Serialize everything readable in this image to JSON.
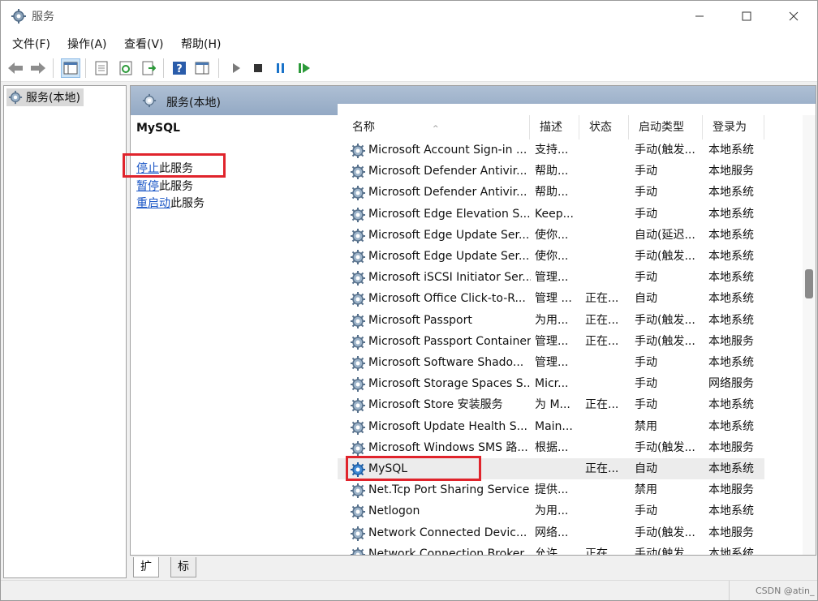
{
  "window": {
    "title": "服务"
  },
  "menu": [
    "文件(F)",
    "操作(A)",
    "查看(V)",
    "帮助(H)"
  ],
  "tree": {
    "root": "服务(本地)"
  },
  "pane": {
    "title": "服务(本地)"
  },
  "extended": {
    "service_name": "MySQL",
    "actions": [
      {
        "link": "停止",
        "rest": "此服务"
      },
      {
        "link": "暂停",
        "rest": "此服务"
      },
      {
        "link": "重启动",
        "rest": "此服务"
      }
    ]
  },
  "columns": [
    "名称",
    "描述",
    "状态",
    "启动类型",
    "登录为"
  ],
  "services": [
    {
      "name": "Microsoft Account Sign-in ...",
      "desc": "支持...",
      "status": "",
      "startup": "手动(触发...",
      "logon": "本地系统"
    },
    {
      "name": "Microsoft Defender Antivir...",
      "desc": "帮助...",
      "status": "",
      "startup": "手动",
      "logon": "本地服务"
    },
    {
      "name": "Microsoft Defender Antivir...",
      "desc": "帮助...",
      "status": "",
      "startup": "手动",
      "logon": "本地系统"
    },
    {
      "name": "Microsoft Edge Elevation S...",
      "desc": "Keep...",
      "status": "",
      "startup": "手动",
      "logon": "本地系统"
    },
    {
      "name": "Microsoft Edge Update Ser...",
      "desc": "使你...",
      "status": "",
      "startup": "自动(延迟...",
      "logon": "本地系统"
    },
    {
      "name": "Microsoft Edge Update Ser...",
      "desc": "使你...",
      "status": "",
      "startup": "手动(触发...",
      "logon": "本地系统"
    },
    {
      "name": "Microsoft iSCSI Initiator Ser...",
      "desc": "管理...",
      "status": "",
      "startup": "手动",
      "logon": "本地系统"
    },
    {
      "name": "Microsoft Office Click-to-R...",
      "desc": "管理 ...",
      "status": "正在...",
      "startup": "自动",
      "logon": "本地系统"
    },
    {
      "name": "Microsoft Passport",
      "desc": "为用...",
      "status": "正在...",
      "startup": "手动(触发...",
      "logon": "本地系统"
    },
    {
      "name": "Microsoft Passport Container",
      "desc": "管理...",
      "status": "正在...",
      "startup": "手动(触发...",
      "logon": "本地服务"
    },
    {
      "name": "Microsoft Software Shado...",
      "desc": "管理...",
      "status": "",
      "startup": "手动",
      "logon": "本地系统"
    },
    {
      "name": "Microsoft Storage Spaces S...",
      "desc": "Micr...",
      "status": "",
      "startup": "手动",
      "logon": "网络服务"
    },
    {
      "name": "Microsoft Store 安装服务",
      "desc": "为 M...",
      "status": "正在...",
      "startup": "手动",
      "logon": "本地系统"
    },
    {
      "name": "Microsoft Update Health S...",
      "desc": "Main...",
      "status": "",
      "startup": "禁用",
      "logon": "本地系统"
    },
    {
      "name": "Microsoft Windows SMS 路...",
      "desc": "根据...",
      "status": "",
      "startup": "手动(触发...",
      "logon": "本地服务"
    },
    {
      "name": "MySQL",
      "desc": "",
      "status": "正在...",
      "startup": "自动",
      "logon": "本地系统"
    },
    {
      "name": "Net.Tcp Port Sharing Service",
      "desc": "提供...",
      "status": "",
      "startup": "禁用",
      "logon": "本地服务"
    },
    {
      "name": "Netlogon",
      "desc": "为用...",
      "status": "",
      "startup": "手动",
      "logon": "本地系统"
    },
    {
      "name": "Network Connected Devic...",
      "desc": "网络...",
      "status": "",
      "startup": "手动(触发...",
      "logon": "本地服务"
    },
    {
      "name": "Network Connection Broker",
      "desc": "允许...",
      "status": "正在...",
      "startup": "手动(触发...",
      "logon": "本地系统"
    }
  ],
  "tabs": [
    "扩展",
    "标准"
  ],
  "watermark": "CSDN @atin_",
  "colors": {
    "highlight": "#e0242c",
    "link": "#1a56c6",
    "header_gradient": "#93a9c4"
  }
}
